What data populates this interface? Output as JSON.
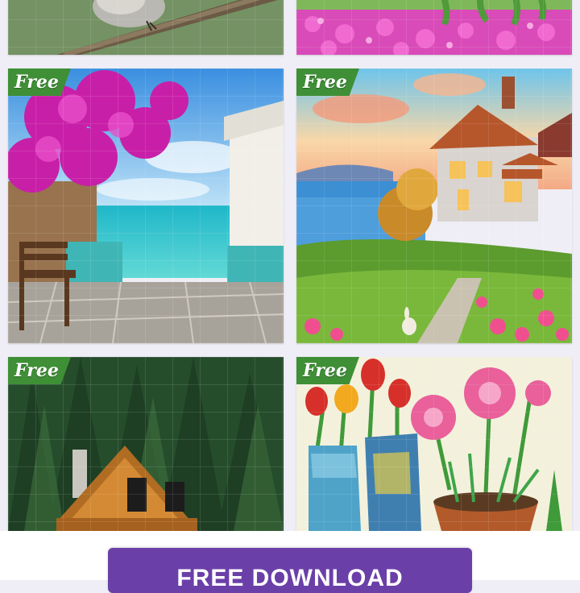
{
  "puzzles": [
    {
      "id_label": "bird-on-branch"
    },
    {
      "id_label": "pink-flowers-field"
    },
    {
      "badge": "Free"
    },
    {
      "badge": "Free"
    },
    {
      "badge": "Free"
    },
    {
      "badge": "Free"
    }
  ],
  "cta": {
    "label": "FREE DOWNLOAD"
  },
  "colors": {
    "badge": "#3f8f36",
    "button": "#6b3fa8",
    "background": "#efeef6"
  }
}
